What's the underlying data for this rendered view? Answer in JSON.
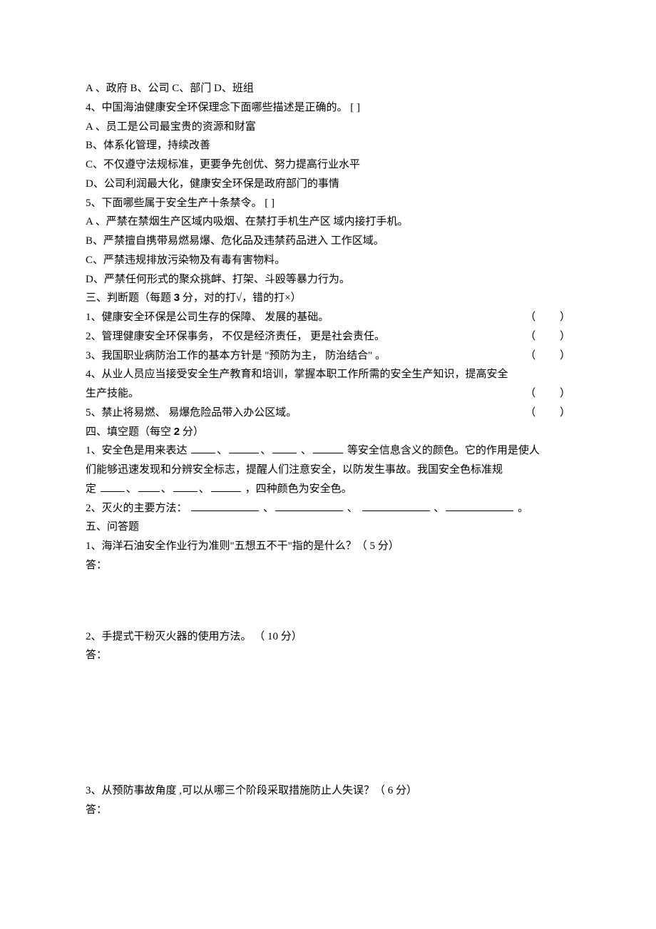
{
  "mc": {
    "q3_options": "A 、政府    B、公司    C、部门    D、班组",
    "q4_stem": "4、中国海油健康安全环保理念下面哪些描述是正确的。       [     ]",
    "q4_a": "A 、员工是公司最宝贵的资源和财富",
    "q4_b": "B、体系化管理，持续改善",
    "q4_c": "C、不仅遵守法规标准，更要争先创优、努力提高行业水平",
    "q4_d": "D、公司利润最大化，健康安全环保是政府部门的事情",
    "q5_stem": "5、下面哪些属于安全生产十条禁令。       [          ]",
    "q5_a": "A 、严禁在禁烟生产区域内吸烟、在禁打手机生产区         域内接打手机。",
    "q5_b": "B、严禁擅自携带易燃易爆、危化品及违禁药品进入        工作区域。",
    "q5_c": "C、严禁违规排放污染物及有毒有害物料。",
    "q5_d": "D、严禁任何形式的聚众挑衅、打架、斗殴等暴力行为。"
  },
  "tf": {
    "heading_pre": "三、判断题（每题  ",
    "heading_score": "3",
    "heading_post": " 分，对的打√，错的打×）",
    "q1": "1、健康安全环保是公司生存的保障、    发展的基础。",
    "q2": "2、管理健康安全环保事务，   不仅是经济责任，  更是社会责任。",
    "q3": "3、我国职业病防治工作的基本方针是    \"预防为主，  防治结合\" 。",
    "q4a": "4、从业人员应当接受安全生产教育和培训，掌握本职工作所需的安全生产知识，提高安全",
    "q4b": "生产技能。",
    "q5": "5、禁止将易燃、  易爆危险品带入办公区域。",
    "bracket": "（         ）"
  },
  "fib": {
    "heading_pre": "四、填空题（每空  ",
    "heading_score": "2",
    "heading_post": " 分）",
    "q1_a": "1、安全色是用来表达  ",
    "q1_b": "等安全信息含义的颜色。它的作用是使人",
    "q1_c": "们能够迅速发现和分辨安全标志，提醒人们注意安全，以防发生事故。我国安全色标准规",
    "q1_d_pre": "定   ",
    "q1_d_post": "，四种颜色为安全色。",
    "q2_a": "2、灭火的主要方法：   ",
    "q2_b": " 。"
  },
  "sa": {
    "heading": "五、问答题",
    "q1": "1、海洋石油安全作业行为准则\"五想五不干\"指的是什么？（          5 分）",
    "q2": "2、手提式干粉灭火器的使用方法。     （ 10  分）",
    "q3": "3、从预防事故角度 ,可以从哪三个阶段采取措施防止人失误？（          6 分）",
    "ans": "答："
  }
}
